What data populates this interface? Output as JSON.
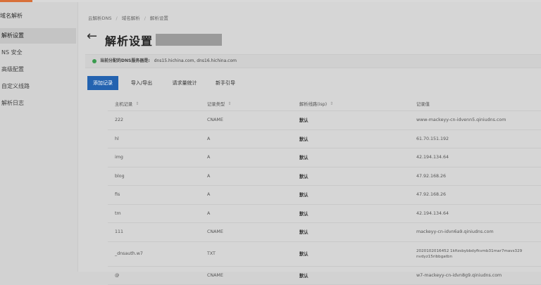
{
  "sidebar": {
    "title": "域名解析",
    "items": [
      {
        "label": "解析设置",
        "active": true
      },
      {
        "label": "NS 安全"
      },
      {
        "label": "高级配置"
      },
      {
        "label": "自定义线路"
      },
      {
        "label": "解析日志"
      }
    ]
  },
  "breadcrumb": [
    "云解析DNS",
    "域名解析",
    "解析设置"
  ],
  "page_title": "解析设置",
  "notice": {
    "label": "当前分配的DNS服务器是:",
    "servers": "dns15.hichina.com, dns16.hichina.com"
  },
  "toolbar": {
    "add": "添加记录",
    "import_export": "导入/导出",
    "stats": "请求量统计",
    "guide": "新手引导"
  },
  "table": {
    "headers": [
      "主机记录",
      "记录类型",
      "解析线路(isp)",
      "记录值"
    ],
    "rows": [
      [
        "222",
        "CNAME",
        "默认",
        "www-mackeyy-cn-idvenn5.qiniudns.com"
      ],
      [
        "hl",
        "A",
        "默认",
        "61.70.151.192"
      ],
      [
        "img",
        "A",
        "默认",
        "42.194.134.64"
      ],
      [
        "blog",
        "A",
        "默认",
        "47.92.168.26"
      ],
      [
        "fis",
        "A",
        "默认",
        "47.92.168.26"
      ],
      [
        "tm",
        "A",
        "默认",
        "42.194.134.64"
      ],
      [
        "111",
        "CNAME",
        "默认",
        "mackeyy-cn-idvn6a9.qiniudns.com"
      ],
      [
        "_dnsauth.w7",
        "TXT",
        "默认",
        "2020102016452 1kfizsbybbdyfkvmb31mar7mavs329 nvdyz15ribbgatbn"
      ],
      [
        "@",
        "CNAME",
        "默认",
        "w7-mackeyy-cn-idvn8g9.qiniudns.com"
      ]
    ]
  }
}
